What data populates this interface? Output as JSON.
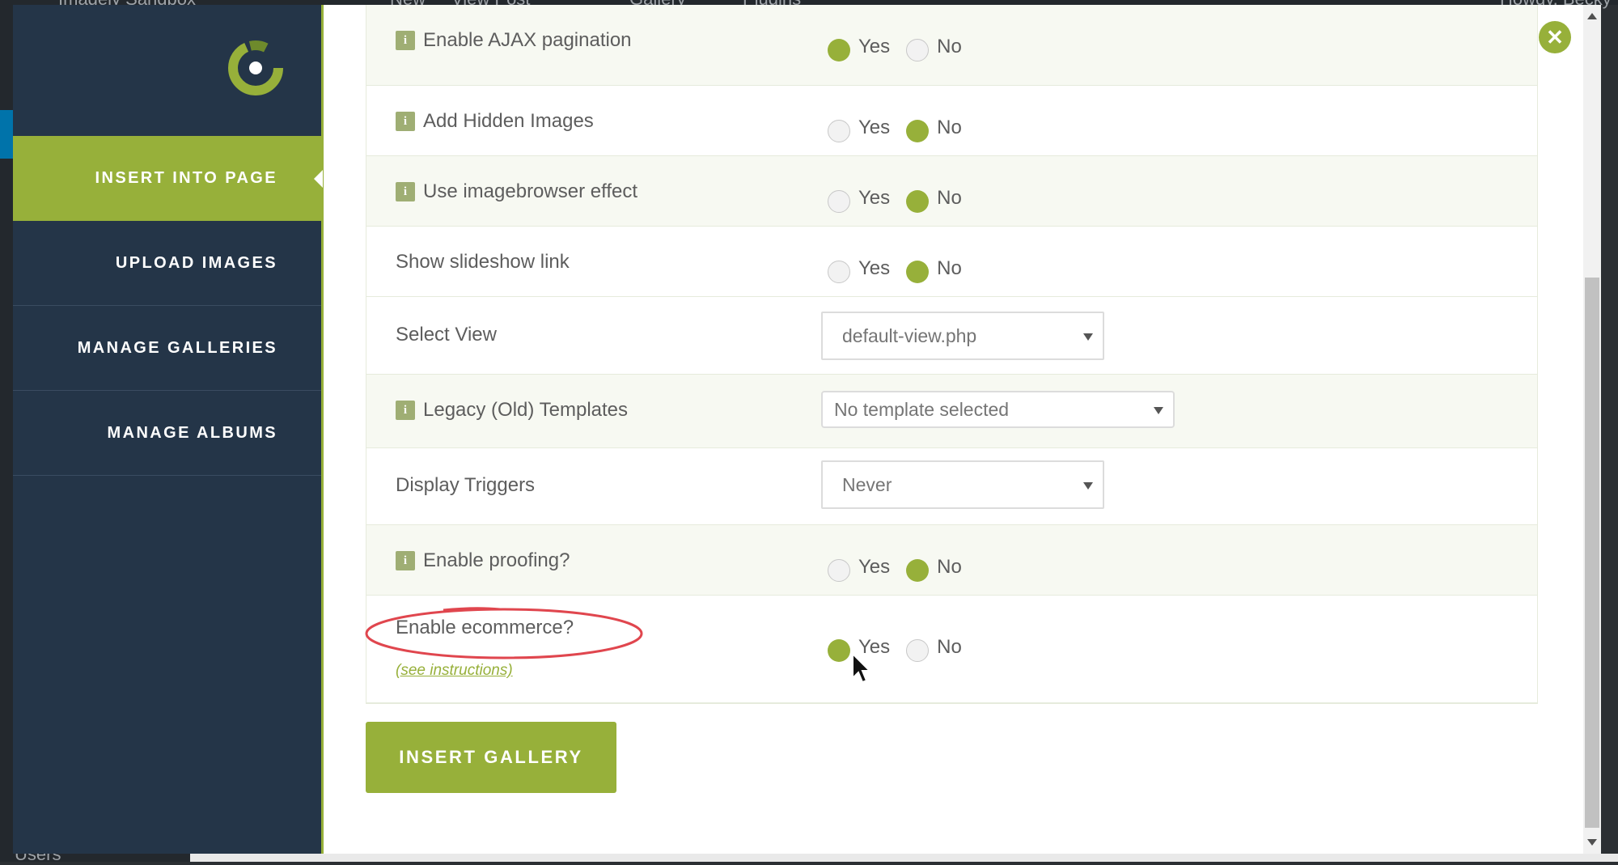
{
  "wp_admin_bar": {
    "site_name": "Imagely Sandbox",
    "items": [
      "New",
      "View Post",
      "Gallery",
      "Plugins"
    ],
    "user_greeting": "Howdy, Becky"
  },
  "wp_sidebar_fragment": {
    "bottom_item": "Users"
  },
  "sidebar": {
    "logo_icon": "nextgen-logo-icon",
    "items": [
      {
        "label": "INSERT INTO PAGE",
        "active": true
      },
      {
        "label": "UPLOAD IMAGES",
        "active": false
      },
      {
        "label": "MANAGE GALLERIES",
        "active": false
      },
      {
        "label": "MANAGE ALBUMS",
        "active": false
      }
    ]
  },
  "close_button": {
    "icon": "close-icon",
    "glyph": "✕"
  },
  "settings": {
    "yes_label": "Yes",
    "no_label": "No",
    "info_glyph": "i",
    "rows": [
      {
        "label": "Enable AJAX pagination",
        "info": true,
        "type": "radio",
        "value": "Yes"
      },
      {
        "label": "Add Hidden Images",
        "info": true,
        "type": "radio",
        "value": "No"
      },
      {
        "label": "Use imagebrowser effect",
        "info": true,
        "type": "radio",
        "value": "No"
      },
      {
        "label": "Show slideshow link",
        "info": false,
        "type": "radio",
        "value": "No"
      },
      {
        "label": "Select View",
        "info": false,
        "type": "select",
        "value": "default-view.php"
      },
      {
        "label": "Legacy (Old) Templates",
        "info": true,
        "type": "select",
        "value": "No template selected"
      },
      {
        "label": "Display Triggers",
        "info": false,
        "type": "select",
        "value": "Never"
      },
      {
        "label": "Enable proofing?",
        "info": true,
        "type": "radio",
        "value": "No"
      },
      {
        "label": "Enable ecommerce?",
        "info": false,
        "type": "radio",
        "value": "Yes",
        "link": "(see instructions)"
      }
    ]
  },
  "insert_button": {
    "label": "INSERT GALLERY"
  },
  "colors": {
    "accent": "#97b03a",
    "sidebar_bg": "#243548",
    "row_alt": "#f7f9f2",
    "highlight_ellipse": "#e0464e"
  }
}
